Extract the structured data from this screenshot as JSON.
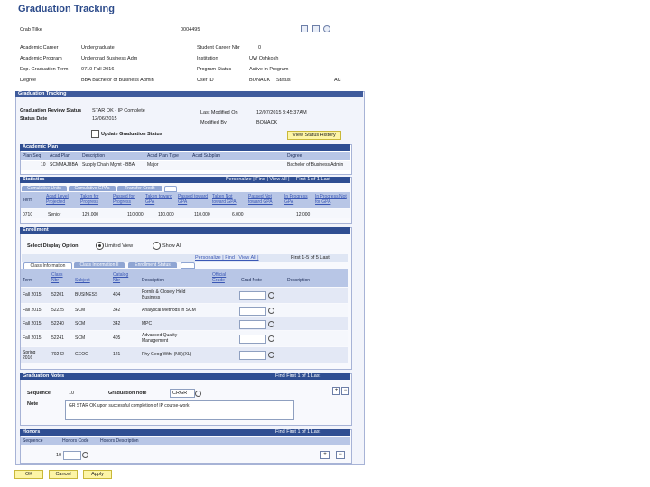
{
  "page_title": "Graduation Tracking",
  "header": {
    "ctrl_label": "Crab Tilke",
    "ctrl_id": "0004495",
    "rows": [
      {
        "l1": "Academic Career",
        "v1": "Undergraduate",
        "l2": "Student Career Nbr",
        "v2": "0"
      },
      {
        "l1": "Academic Program",
        "v1": "Undergrad Business Adm",
        "l2": "Institution",
        "v2": "UW Oshkosh"
      },
      {
        "l1": "Exp. Graduation Term",
        "v1": "0710      Fall 2016",
        "l2": "Program Status",
        "v2": "Active in Program"
      },
      {
        "l1": "Degree",
        "v1": "BBA      Bachelor of Business Admin",
        "l2": "User ID",
        "v2": "BONACK",
        "l3": "Status",
        "v3": "AC"
      }
    ]
  },
  "grad": {
    "bar": "Graduation Tracking",
    "review_status_label": "Graduation Review Status",
    "review_status_value": "STAR OK - IP Complete",
    "status_date_label": "Status Date",
    "status_date_value": "12/06/2015",
    "last_modified_label": "Last Modified On",
    "last_modified_value": "12/07/2015 3:45:37AM",
    "modified_by_label": "Modified By",
    "modified_by_value": "BONACK",
    "update_checkbox_label": "Update Graduation Status",
    "view_history_btn": "View Status History"
  },
  "plan": {
    "bar": "Academic Plan",
    "headers": [
      "Plan Seq",
      "Acad Plan",
      "Description",
      "Acad Plan Type",
      "Acad Subplan",
      "Degree"
    ],
    "row": [
      "10",
      "SCMMAJBBA",
      "Supply Chain Mgmt - BBA",
      "Major",
      "",
      "Bachelor of Business Admin"
    ]
  },
  "stats": {
    "bar": "Statistics",
    "nav": "Personalize | Find | View All |",
    "pager": "First  1 of 1  Last",
    "tabs": [
      "Cumulative Units",
      "Cumulative GPAs",
      "Transfer Credit"
    ],
    "headers": [
      "Term",
      "Acad Level Projected",
      "Taken for Progress",
      "Passed for Progress",
      "Taken toward GPA",
      "Passed toward GPA",
      "Taken Not toward GPA",
      "Passed Not toward GPA",
      "In Progress GPA",
      "In Progress Not for GPA"
    ],
    "row": [
      "0710",
      "Senior",
      "129.000",
      "110.000",
      "110.000",
      "110.000",
      "6.000",
      "",
      "12.000",
      ""
    ]
  },
  "enroll": {
    "bar": "Enrollment",
    "display_label": "Select Display Option:",
    "opt_limited": "Limited View",
    "opt_show_all": "Show All",
    "nav": "Personalize | Find | View All |",
    "pager": "First  1-5 of 5  Last",
    "tabs": [
      "Class Information",
      "Class Information II",
      "Enrollment Status"
    ],
    "headers": [
      "Term",
      "Class Nbr",
      "Subject",
      "Catalog Nbr",
      "Description",
      "Official Grade",
      "Grad Note",
      "Description"
    ],
    "rows": [
      [
        "Fall 2015",
        "52201",
        "BUSINESS",
        "404",
        "Fornih & Closely Held Business",
        ""
      ],
      [
        "Fall 2015",
        "52225",
        "SCM",
        "342",
        "Analytical Methods in SCM",
        ""
      ],
      [
        "Fall 2015",
        "52240",
        "SCM",
        "342",
        "MPC",
        ""
      ],
      [
        "Fall 2015",
        "52241",
        "SCM",
        "405",
        "Advanced Quality Management",
        ""
      ],
      [
        "Spring 2016",
        "70242",
        "GEOG",
        "121",
        "Phy Geog Wthr (NS)(XL)",
        ""
      ]
    ]
  },
  "gradnote": {
    "bar": "Graduation Notes",
    "pager": "Find  First  1 of 1  Last",
    "seq_label": "Sequence",
    "seq_value": "10",
    "note_label": "Graduation note",
    "note_code": "CRGR",
    "text_label": "Note",
    "text_value": "GR STAR OK upon successful completion of IP course-work"
  },
  "honors": {
    "bar": "Honors",
    "pager": "Find  First  1 of 1  Last",
    "headers": [
      "Sequence",
      "Honors Code",
      "Honors Description"
    ],
    "row_seq": "10"
  },
  "footer": {
    "ok": "OK",
    "cancel": "Cancel",
    "apply": "Apply"
  }
}
